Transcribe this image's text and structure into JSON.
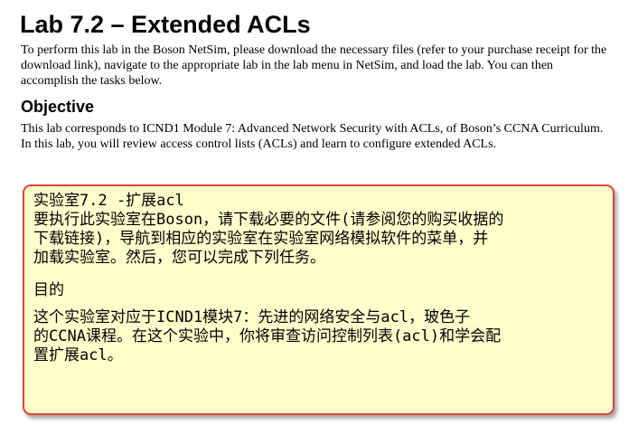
{
  "title": "Lab 7.2 – Extended ACLs",
  "intro": "To perform this lab in the Boson NetSim, please download the necessary files (refer to your purchase receipt for the download link), navigate to the appropriate lab in the lab menu in NetSim, and load the lab. You can then accomplish the tasks below.",
  "objective": {
    "heading": "Objective",
    "text": "This lab corresponds to ICND1 Module 7: Advanced Network Security with ACLs, of Boson’s CCNA Curriculum. In this lab, you will review access control lists (ACLs) and learn to configure extended ACLs."
  },
  "translation": {
    "border_color": "#e0413a",
    "background_color": "#ffffcc",
    "lines": [
      "实验室7.2 -扩展acl",
      "要执行此实验室在Boson，请下载必要的文件(请参阅您的购买收据的",
      "下载链接)，导航到相应的实验室在实验室网络模拟软件的菜单，并",
      "加载实验室。然后，您可以完成下列任务。",
      "目的",
      "这个实验室对应于ICND1模块7：先进的网络安全与acl，玻色子",
      "的CCNA课程。在这个实验中，你将审查访问控制列表(acl)和学会配",
      "置扩展acl。"
    ]
  }
}
